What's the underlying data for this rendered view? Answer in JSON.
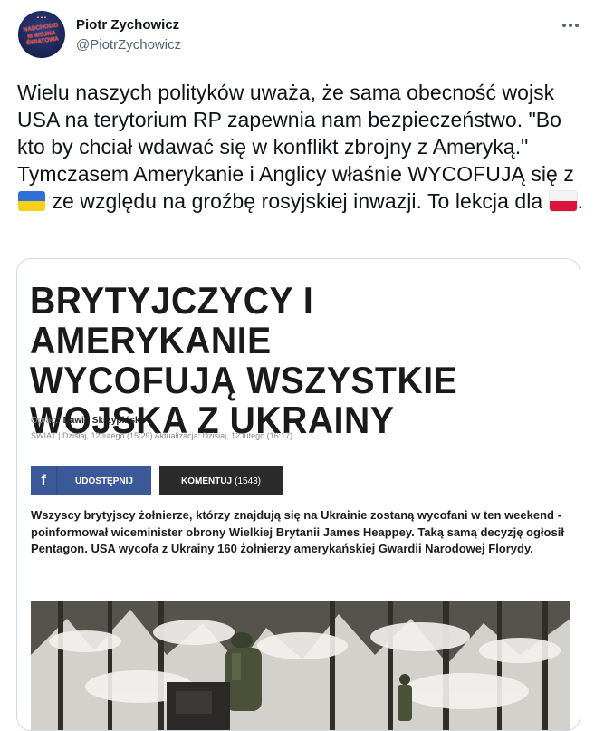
{
  "author": {
    "name": "Piotr Zychowicz",
    "handle": "@PiotrZychowicz",
    "avatar_text": [
      "NADCHODZI",
      "III WOJNA",
      "ŚWIATOWA"
    ]
  },
  "tweet": {
    "text_1": "Wielu naszych polityków uważa, że sama obecność wojsk USA na terytorium RP zapewnia nam bezpieczeństwo. \"Bo kto by chciał wdawać się w konflikt zbrojny z Ameryką.\" Tymczasem Amerykanie i Anglicy właśnie WYCOFUJĄ się z",
    "text_2": "ze względu na groźbę rosyjskiej inwazji. To lekcja dla",
    "text_3": ".",
    "flag_1": "ukraine-flag",
    "flag_2": "poland-flag"
  },
  "article": {
    "headline_1": "BRYTYJCZYCY I AMERYKANIE",
    "headline_2": "WYCOFUJĄ WSZYSTKIE",
    "headline_3": "WOJSKA Z UKRAINY",
    "byline_label": "Oprac.:",
    "byline_author": "Dawid Skrzypiński",
    "meta": "ŚWIAT  |  Dzisiaj, 12 lutego (15:29) Aktualizacja: Dzisiaj, 12 lutego (16:17)",
    "share_label": "UDOSTĘPNIJ",
    "comment_label": "KOMENTUJ",
    "comment_count": "(1543)",
    "lead": "Wszyscy brytyjscy żołnierze, którzy znajdują się na Ukrainie zostaną wycofani w ten weekend - poinformował wiceminister obrony Wielkiej Brytanii James Heappey. Taką samą decyzję ogłosił Pentagon. USA wycofa z Ukrainy 160 żołnierzy amerykańskiej Gwardii Narodowej Florydy."
  },
  "colors": {
    "facebook": "#3b5998",
    "comment_bg": "#2b2b2b",
    "handle": "#536471"
  }
}
